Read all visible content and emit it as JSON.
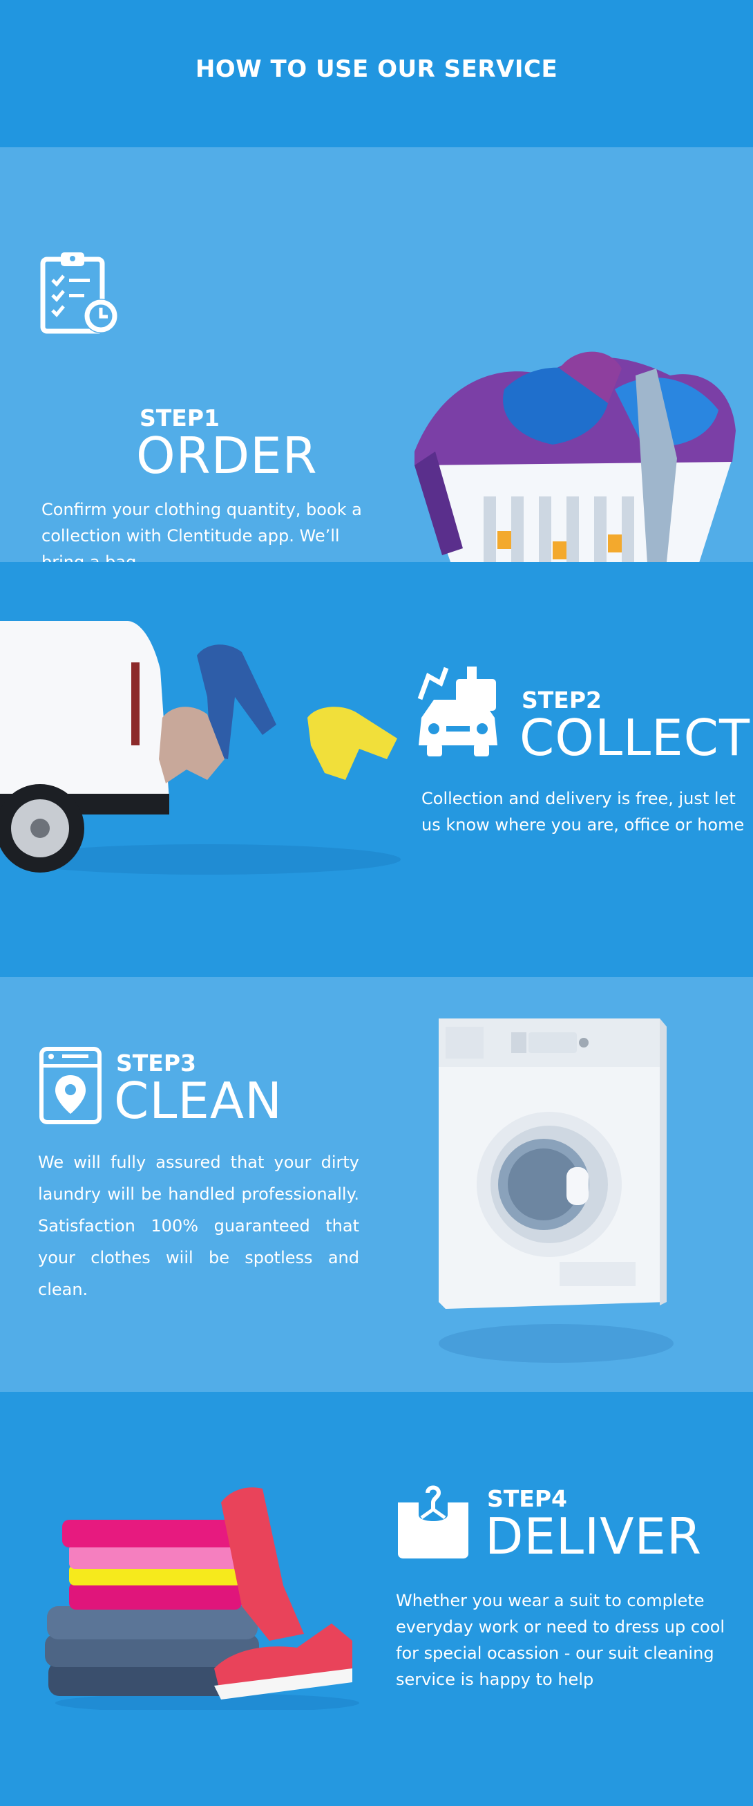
{
  "header": {
    "title": "HOW TO USE OUR SERVICE"
  },
  "steps": [
    {
      "number": "STEP1",
      "name": "ORDER",
      "icon": "clipboard-clock-icon",
      "description": "Confirm your clothing quantity, book a collection with Clentitude app. We’ll bring a bag.",
      "image": "laundry-basket-illustration"
    },
    {
      "number": "STEP2",
      "name": "COLLECT",
      "icon": "car-clothes-icon",
      "description": "Collection and delivery is free, just let us know where you are, office or home",
      "image": "van-with-flying-clothes-illustration"
    },
    {
      "number": "STEP3",
      "name": "CLEAN",
      "icon": "washer-location-icon",
      "description": "We will fully assured that your dirty laundry will be handled professionally. Satisfaction 100% guaranteed that your clothes wiil be spotless and clean.",
      "image": "washing-machine-illustration"
    },
    {
      "number": "STEP4",
      "name": "DELIVER",
      "icon": "hanger-box-icon",
      "description": "Whether you wear  a suit to complete everyday work or need to dress up cool for special ocassion - our suit cleaning service is happy to help",
      "image": "folded-clothes-sneakers-illustration"
    }
  ],
  "colors": {
    "dark_blue": "#2196e0",
    "light_blue": "#52ade8",
    "text": "#ffffff"
  }
}
